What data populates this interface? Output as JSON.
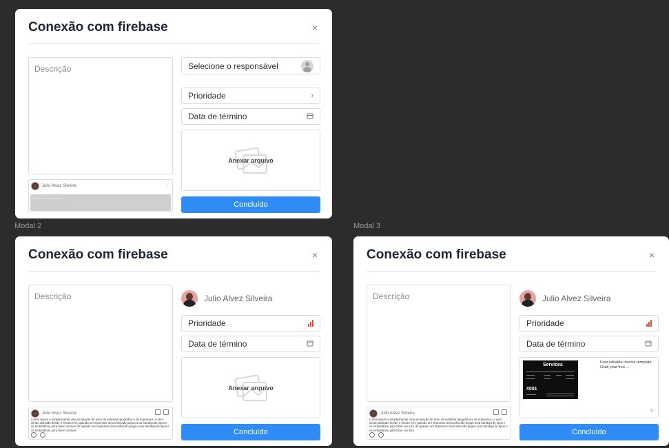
{
  "frames": [
    {
      "label": "",
      "title": "Conexão com firebase",
      "close": "×",
      "description_placeholder": "Descrição",
      "comment": {
        "author": "Julio Alvez Silveira",
        "menu": "⋮",
        "input_placeholder": "Adicione um comentário",
        "text": ""
      },
      "assignee_select": "Selecione o responsável",
      "priority": "Prioridade",
      "due_date": "Data de término",
      "attach_label": "Anexar arquivo",
      "done_button": "Concluído"
    },
    {
      "label": "Modal 2",
      "title": "Conexão com firebase",
      "close": "×",
      "description_placeholder": "Descrição",
      "comment": {
        "author": "Julio Alvez Silveira",
        "text": "Lorem Ipsum é simplesmente uma simulação de texto da indústria tipográfica e de impressos, e vem sendo utilizado desde o século XVI, quando um impressor desconhecido pegou uma bandeja de tipos e os embaralhou para fazer um livro de quando um impressor desconhecido pegou uma bandeja de tipos e os embaralhou para fazer um livro."
      },
      "assignee_name": "Julio Alvez Silveira",
      "priority": "Prioridade",
      "due_date": "Data de término",
      "attach_label": "Anexar arquivo",
      "done_button": "Concluído"
    },
    {
      "label": "Modal 3",
      "title": "Conexão com firebase",
      "close": "×",
      "description_placeholder": "Descrição",
      "comment": {
        "author": "Julio Alvez Silveira",
        "text": "Lorem Ipsum é simplesmente uma simulação de texto da indústria tipográfica e de impressos, e vem sendo utilizado desde o século XVI, quando um impressor desconhecido pegou uma bandeja de tipos e os embaralhou para fazer um livro de quando um impressor desconhecido pegou uma bandeja de tipos e os embaralhou para fazer um livro."
      },
      "assignee_name": "Julio Alvez Silveira",
      "priority": "Prioridade",
      "due_date": "Data de término",
      "attachment": {
        "thumb_title": "Services",
        "thumb_number": "#001",
        "file_name": "Free editable invoice template Grab your free ...",
        "add": "+"
      },
      "done_button": "Concluído"
    }
  ],
  "colors": {
    "canvas": "#2c2c2c",
    "primary": "#2f8cf7",
    "priority_high": "#e24c3b"
  },
  "icons": {
    "close": "close-icon",
    "calendar": "calendar-icon",
    "chevron": "chevron-right-icon",
    "priority": "priority-bars-icon",
    "attach": "attach-file-icon",
    "user": "user-placeholder-icon"
  }
}
